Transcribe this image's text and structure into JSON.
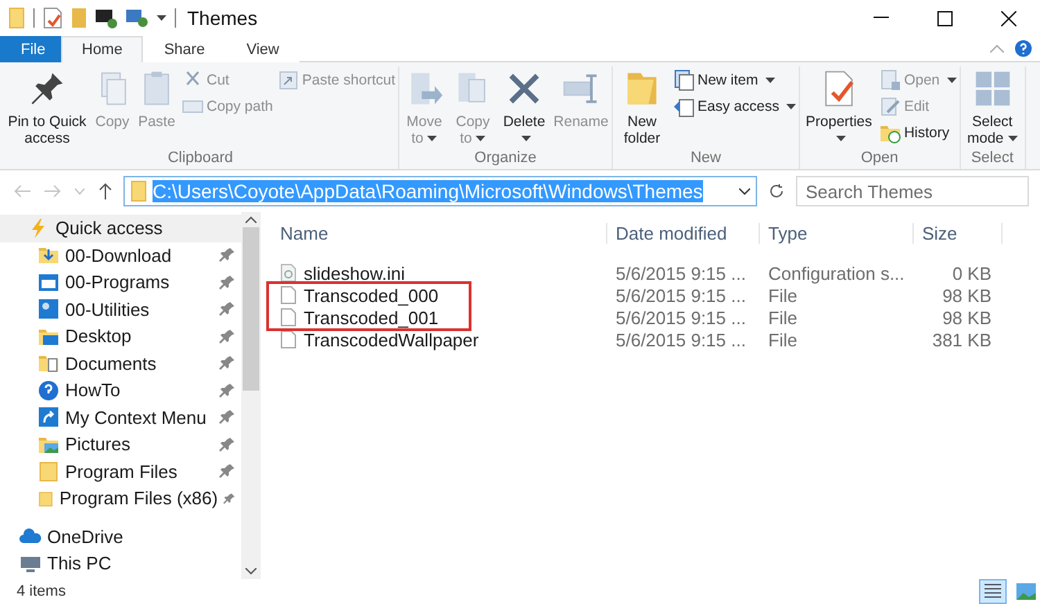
{
  "window": {
    "title": "Themes"
  },
  "tabs": [
    {
      "label": "File",
      "kind": "file",
      "selected": false
    },
    {
      "label": "Home",
      "kind": "tab",
      "selected": true
    },
    {
      "label": "Share",
      "kind": "tab",
      "selected": false
    },
    {
      "label": "View",
      "kind": "tab",
      "selected": false
    }
  ],
  "ribbon": [
    {
      "label": "Clipboard",
      "commands": [
        {
          "label": "Pin to Quick access",
          "kind": "large",
          "disabled": false
        },
        {
          "label": "Copy",
          "kind": "large",
          "disabled": true
        },
        {
          "label": "Paste",
          "kind": "large",
          "disabled": true
        },
        {
          "kind": "stack",
          "items": [
            {
              "label": "Cut",
              "disabled": true
            },
            {
              "label": "Copy path",
              "disabled": true
            }
          ]
        },
        {
          "kind": "stack",
          "items": [
            {
              "label": "Paste shortcut",
              "disabled": true
            }
          ]
        }
      ]
    },
    {
      "label": "Organize",
      "commands": [
        {
          "label": "Move to",
          "kind": "large",
          "disabled": true,
          "dropdown": true
        },
        {
          "label": "Copy to",
          "kind": "large",
          "disabled": true,
          "dropdown": true
        },
        {
          "label": "Delete",
          "kind": "large",
          "disabled": false,
          "dropdown": true
        },
        {
          "label": "Rename",
          "kind": "large",
          "disabled": true
        }
      ]
    },
    {
      "label": "New",
      "commands": [
        {
          "label": "New folder",
          "kind": "large",
          "disabled": false
        },
        {
          "kind": "stack",
          "items": [
            {
              "label": "New item",
              "disabled": false,
              "dropdown": true
            },
            {
              "label": "Easy access",
              "disabled": false,
              "dropdown": true
            }
          ]
        }
      ]
    },
    {
      "label": "Open",
      "commands": [
        {
          "label": "Properties",
          "kind": "large",
          "disabled": false,
          "dropdown": true
        },
        {
          "kind": "stack",
          "items": [
            {
              "label": "Open",
              "disabled": true,
              "dropdown": true
            },
            {
              "label": "Edit",
              "disabled": true
            },
            {
              "label": "History",
              "disabled": false
            }
          ]
        }
      ]
    },
    {
      "label": "Select",
      "commands": [
        {
          "label": "Select mode",
          "kind": "large",
          "disabled": false,
          "dropdown": true
        }
      ]
    }
  ],
  "address": {
    "path": "C:\\Users\\Coyote\\AppData\\Roaming\\Microsoft\\Windows\\Themes"
  },
  "search": {
    "placeholder": "Search Themes"
  },
  "sidebar": {
    "items": [
      {
        "label": "Quick access",
        "selected": true,
        "pinned": false,
        "children": [
          {
            "label": "00-Download",
            "selected": false,
            "pinned": true
          },
          {
            "label": "00-Programs",
            "selected": false,
            "pinned": true
          },
          {
            "label": "00-Utilities",
            "selected": false,
            "pinned": true
          },
          {
            "label": "Desktop",
            "selected": false,
            "pinned": true
          },
          {
            "label": "Documents",
            "selected": false,
            "pinned": true
          },
          {
            "label": "HowTo",
            "selected": false,
            "pinned": true
          },
          {
            "label": "My Context Menu",
            "selected": false,
            "pinned": true
          },
          {
            "label": "Pictures",
            "selected": false,
            "pinned": true
          },
          {
            "label": "Program Files",
            "selected": false,
            "pinned": true
          },
          {
            "label": "Program Files (x86)",
            "selected": false,
            "pinned": true
          }
        ]
      },
      {
        "label": "OneDrive",
        "selected": false,
        "pinned": false
      },
      {
        "label": "This PC",
        "selected": false,
        "pinned": false
      }
    ]
  },
  "table": {
    "columns": [
      "Name",
      "Date modified",
      "Type",
      "Size"
    ],
    "rows": [
      {
        "name": "slideshow.ini",
        "date": "5/6/2015 9:15 ...",
        "type": "Configuration s...",
        "size": "0 KB",
        "kind": "settings",
        "annotated": false
      },
      {
        "name": "Transcoded_000",
        "date": "5/6/2015 9:15 ...",
        "type": "File",
        "size": "98 KB",
        "kind": "file",
        "annotated": true
      },
      {
        "name": "Transcoded_001",
        "date": "5/6/2015 9:15 ...",
        "type": "File",
        "size": "98 KB",
        "kind": "file",
        "annotated": true
      },
      {
        "name": "TranscodedWallpaper",
        "date": "5/6/2015 9:15 ...",
        "type": "File",
        "size": "381 KB",
        "kind": "file",
        "annotated": false
      }
    ]
  },
  "status_bar": {
    "count": "4 items",
    "views": [
      {
        "kind": "details",
        "selected": true
      },
      {
        "kind": "large",
        "selected": false
      }
    ]
  }
}
